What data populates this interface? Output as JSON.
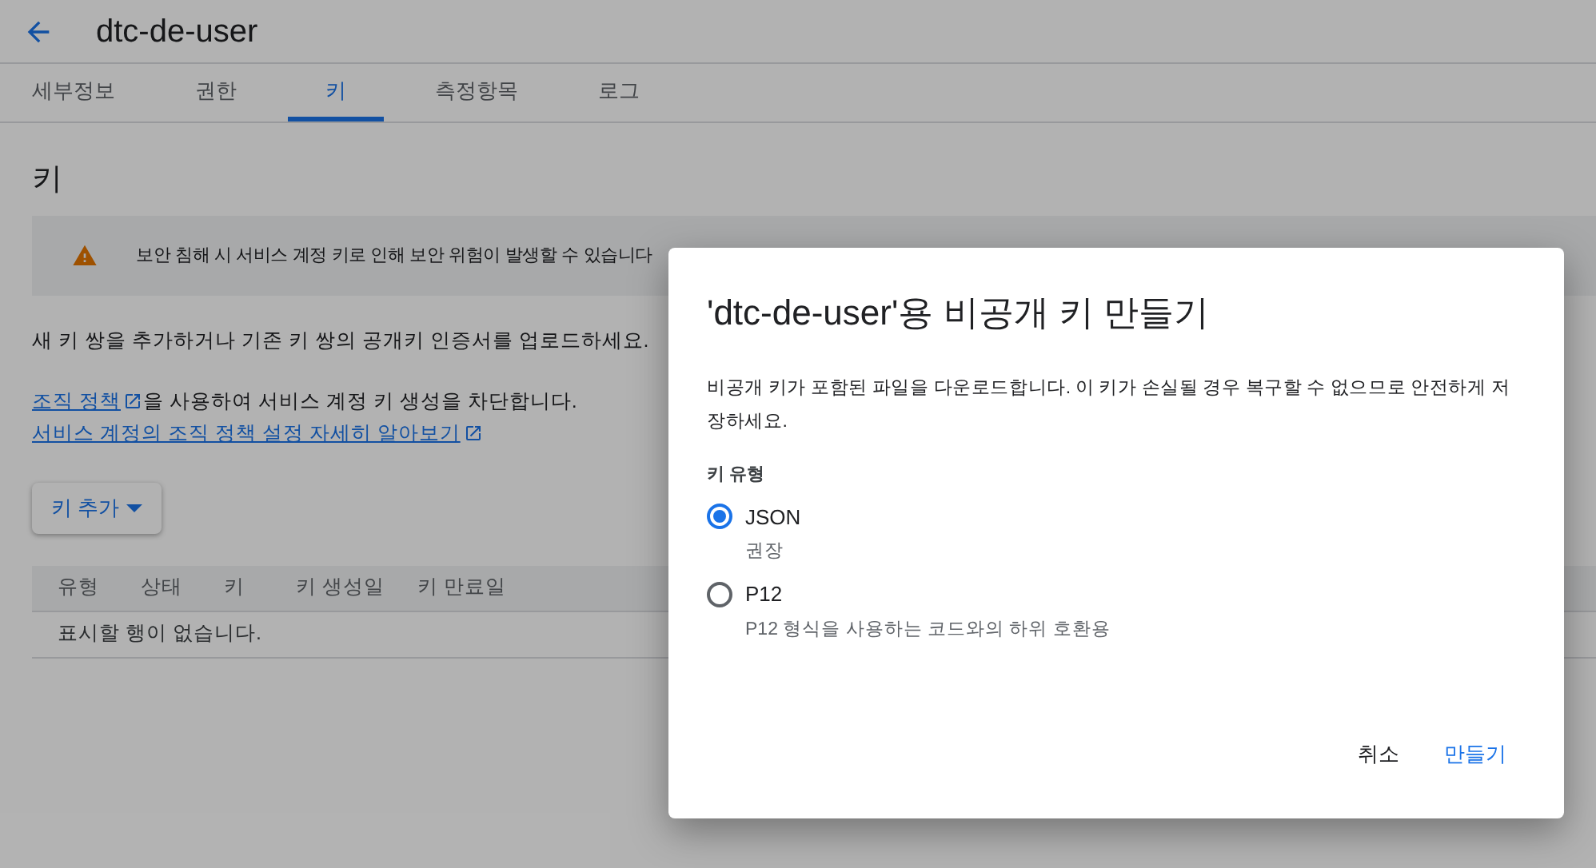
{
  "header": {
    "title": "dtc-de-user"
  },
  "tabs": [
    {
      "label": "세부정보",
      "selected": false
    },
    {
      "label": "권한",
      "selected": false
    },
    {
      "label": "키",
      "selected": true
    },
    {
      "label": "측정항목",
      "selected": false
    },
    {
      "label": "로그",
      "selected": false
    }
  ],
  "section_title": "키",
  "warning": "보안 침해 시 서비스 계정 키로 인해 보안 위험이 발생할 수 있습니다",
  "intro": "새 키 쌍을 추가하거나 기존 키 쌍의 공개키 인증서를 업로드하세요.",
  "policy_link": "조직 정책",
  "policy_text": "을 사용하여 서비스 계정 키 생성을 차단합니다.",
  "learn_link": "서비스 계정의 조직 정책 설정 자세히 알아보기",
  "add_key_button": "키 추가",
  "table": {
    "columns": [
      "유형",
      "상태",
      "키",
      "키 생성일",
      "키 만료일"
    ],
    "empty_message": "표시할 행이 없습니다."
  },
  "dialog": {
    "title": "'dtc-de-user'용 비공개 키 만들기",
    "description": "비공개 키가 포함된 파일을 다운로드합니다. 이 키가 손실될 경우 복구할 수 없으므로 안전하게 저장하세요.",
    "key_type_label": "키 유형",
    "options": [
      {
        "label": "JSON",
        "hint": "권장",
        "selected": true
      },
      {
        "label": "P12",
        "hint": "P12 형식을 사용하는 코드와의 하위 호환용",
        "selected": false
      }
    ],
    "buttons": [
      {
        "label": "취소",
        "kind": "secondary"
      },
      {
        "label": "만들기",
        "kind": "primary"
      }
    ]
  }
}
